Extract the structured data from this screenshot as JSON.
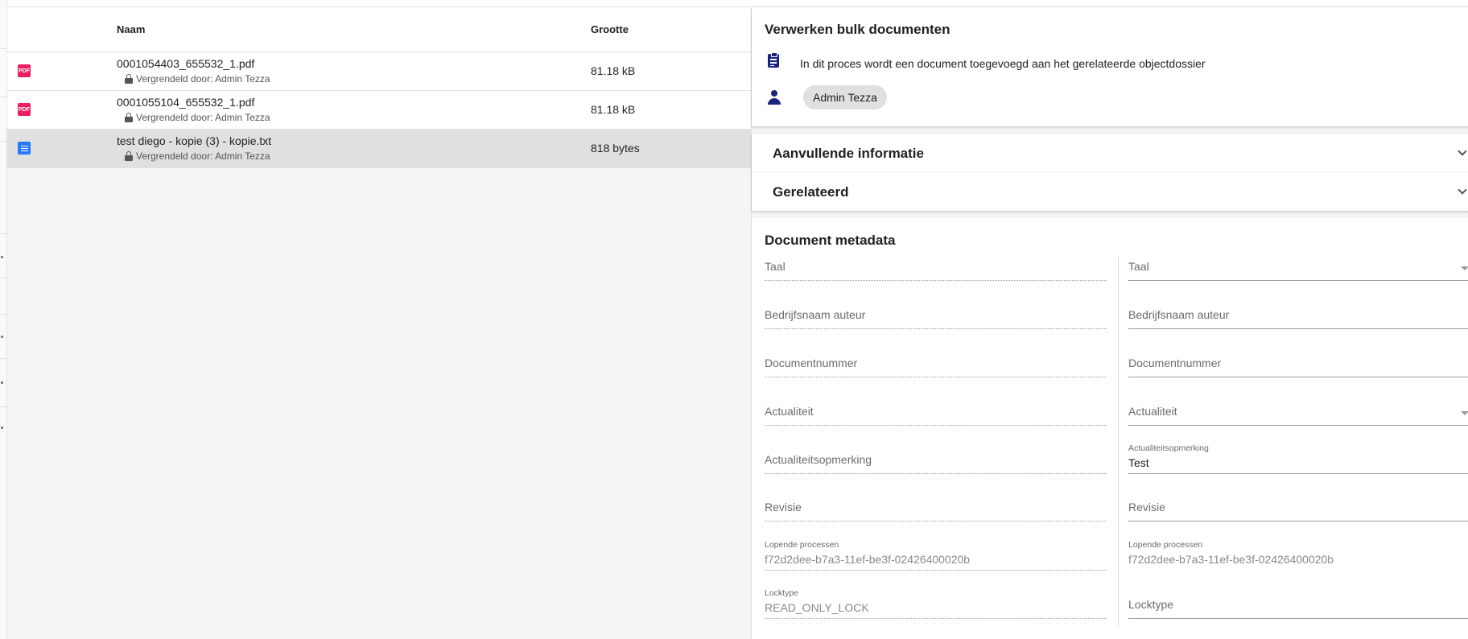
{
  "file_list": {
    "header": {
      "name": "Naam",
      "size": "Grootte"
    },
    "rows": [
      {
        "icon": "pdf-icon",
        "icon_label": "PDF",
        "name": "0001054403_655532_1.pdf",
        "lock": "Vergrendeld door: Admin Tezza",
        "size": "81.18 kB",
        "selected": false
      },
      {
        "icon": "pdf-icon",
        "icon_label": "PDF",
        "name": "0001055104_655532_1.pdf",
        "lock": "Vergrendeld door: Admin Tezza",
        "size": "81.18 kB",
        "selected": false
      },
      {
        "icon": "text-file-icon",
        "name": "test diego - kopie (3) - kopie.txt",
        "lock": "Vergrendeld door: Admin Tezza",
        "size": "818 bytes",
        "selected": true
      }
    ]
  },
  "process": {
    "title": "Verwerken bulk documenten",
    "description": "In dit proces wordt een document toegevoegd aan het gerelateerde objectdossier",
    "user_chip": "Admin Tezza"
  },
  "accordion": {
    "items": [
      {
        "label": "Aanvullende informatie"
      },
      {
        "label": "Gerelateerd"
      }
    ]
  },
  "metadata": {
    "title": "Document metadata",
    "left": {
      "taal": "Taal",
      "bedrijfsnaam": "Bedrijfsnaam auteur",
      "documentnummer": "Documentnummer",
      "actualiteit": "Actualiteit",
      "actualiteitsopmerking": "Actualiteitsopmerking",
      "revisie": "Revisie",
      "lopende_label": "Lopende processen",
      "lopende_value": "f72d2dee-b7a3-11ef-be3f-02426400020b",
      "locktype_label": "Locktype",
      "locktype_value": "READ_ONLY_LOCK"
    },
    "right": {
      "taal": "Taal",
      "bedrijfsnaam": "Bedrijfsnaam auteur",
      "documentnummer": "Documentnummer",
      "actualiteit": "Actualiteit",
      "actualiteitsopmerking_label": "Actualiteitsopmerking",
      "actualiteitsopmerking_value": "Test",
      "revisie": "Revisie",
      "lopende_label": "Lopende processen",
      "lopende_value": "f72d2dee-b7a3-11ef-be3f-02426400020b",
      "locktype": "Locktype"
    }
  },
  "colors": {
    "pdf_icon": "#e91e63",
    "text_icon": "#2979ff",
    "primary_icon": "#1a237e",
    "selected_row": "#e0e0e0"
  }
}
